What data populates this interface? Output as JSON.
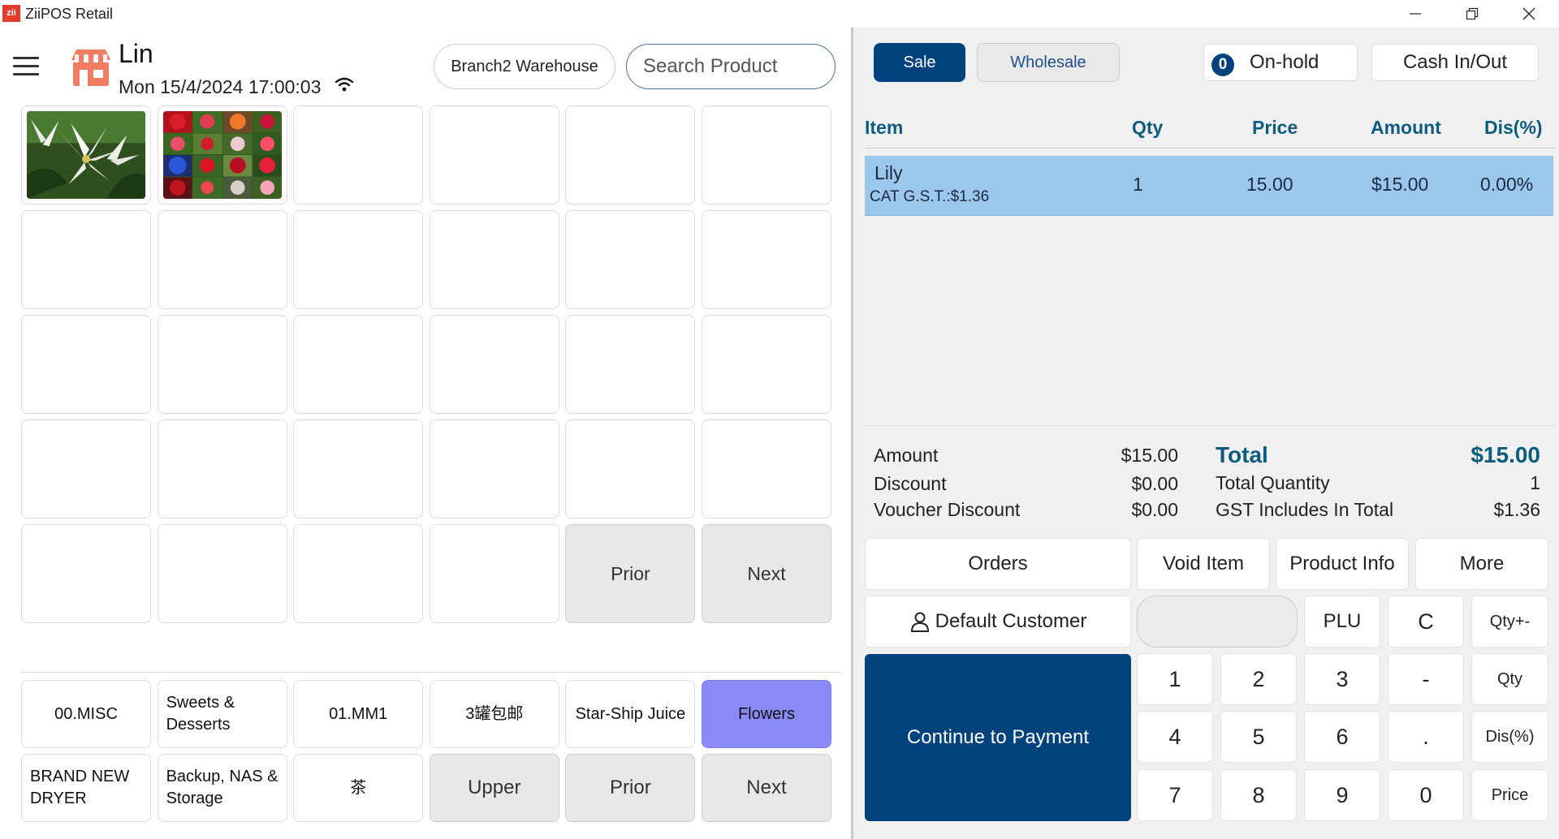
{
  "app": {
    "logo_text": "zii",
    "title": "ZiiPOS Retail"
  },
  "header": {
    "user_name": "Lin",
    "datetime": "Mon 15/4/2024 17:00:03",
    "branch": "Branch2 Warehouse",
    "search_placeholder": "Search Product"
  },
  "products": {
    "prior_label": "Prior",
    "next_label": "Next"
  },
  "categories": {
    "items": [
      "00.MISC",
      "Sweets & Desserts",
      "01.MM1",
      "3罐包邮",
      "Star-Ship Juice",
      "Flowers",
      "BRAND NEW DRYER",
      "Backup, NAS & Storage",
      "茶"
    ],
    "active": "Flowers",
    "upper_label": "Upper",
    "prior_label": "Prior",
    "next_label": "Next"
  },
  "order": {
    "sale_label": "Sale",
    "wholesale_label": "Wholesale",
    "onhold_count": "0",
    "onhold_label": "On-hold",
    "cash_label": "Cash In/Out",
    "columns": {
      "item": "Item",
      "qty": "Qty",
      "price": "Price",
      "amount": "Amount",
      "disc": "Dis(%)"
    },
    "lines": [
      {
        "name": "Lily",
        "tax": "CAT G.S.T.:$1.36",
        "qty": "1",
        "price": "15.00",
        "amount": "$15.00",
        "disc": "0.00%"
      }
    ]
  },
  "summary": {
    "amount_label": "Amount",
    "amount": "$15.00",
    "discount_label": "Discount",
    "discount": "$0.00",
    "voucher_label": "Voucher Discount",
    "voucher": "$0.00",
    "total_label": "Total",
    "total": "$15.00",
    "total_qty_label": "Total Quantity",
    "total_qty": "1",
    "gst_label": "GST Includes In Total",
    "gst": "$1.36"
  },
  "actions": {
    "orders": "Orders",
    "void_item": "Void Item",
    "product_info": "Product Info",
    "more": "More",
    "default_customer": "Default Customer",
    "plu": "PLU",
    "clear": "C",
    "qty_pm": "Qty+-",
    "qty": "Qty",
    "disc": "Dis(%)",
    "price": "Price",
    "continue_payment": "Continue to Payment"
  },
  "keypad": [
    "1",
    "2",
    "3",
    "-",
    "4",
    "5",
    "6",
    ".",
    "7",
    "8",
    "9",
    "0"
  ],
  "colors": {
    "primary": "#00427e",
    "active_category": "#8a8af6",
    "selected_row": "#9cc7ec",
    "heading": "#0c5c7e"
  }
}
